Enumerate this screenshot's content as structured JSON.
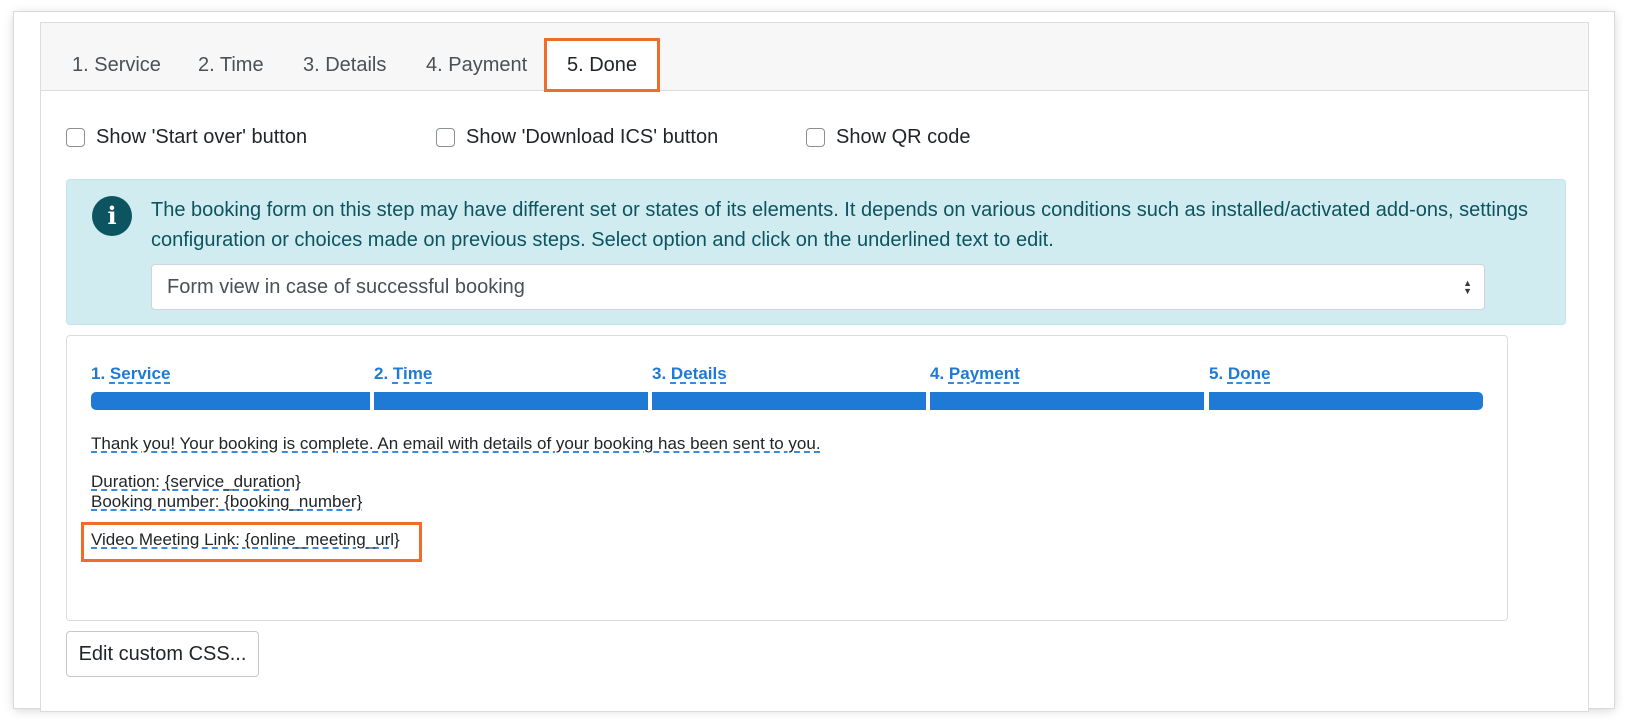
{
  "tabs": [
    {
      "label": "1. Service"
    },
    {
      "label": "2. Time"
    },
    {
      "label": "3. Details"
    },
    {
      "label": "4. Payment"
    },
    {
      "label": "5. Done",
      "active": true
    }
  ],
  "options": [
    {
      "label": "Show 'Start over' button",
      "checked": false
    },
    {
      "label": "Show 'Download ICS' button",
      "checked": false
    },
    {
      "label": "Show QR code",
      "checked": false
    }
  ],
  "alert": {
    "icon": "info-icon",
    "text": "The booking form on this step may have different set or states of its elements. It depends on various conditions such as installed/activated add-ons, settings configuration or choices made on previous steps. Select option and click on the underlined text to edit.",
    "select_value": "Form view in case of successful booking"
  },
  "preview": {
    "steps": [
      {
        "num": "1.",
        "label": "Service"
      },
      {
        "num": "2.",
        "label": "Time"
      },
      {
        "num": "3.",
        "label": "Details"
      },
      {
        "num": "4.",
        "label": "Payment"
      },
      {
        "num": "5.",
        "label": "Done"
      }
    ],
    "thank_you": "Thank you! Your booking is complete. An email with details of your booking has been sent to you.",
    "duration": "Duration: {service_duration}",
    "booking_number": "Booking number: {booking_number}",
    "video_link": "Video Meeting Link: {online_meeting_url}"
  },
  "edit_css_label": "Edit custom CSS...",
  "colors": {
    "accent": "#1f7ad6",
    "highlight": "#ef6c2b",
    "alert_bg": "#d1ecf1",
    "alert_text": "#0c5460"
  }
}
